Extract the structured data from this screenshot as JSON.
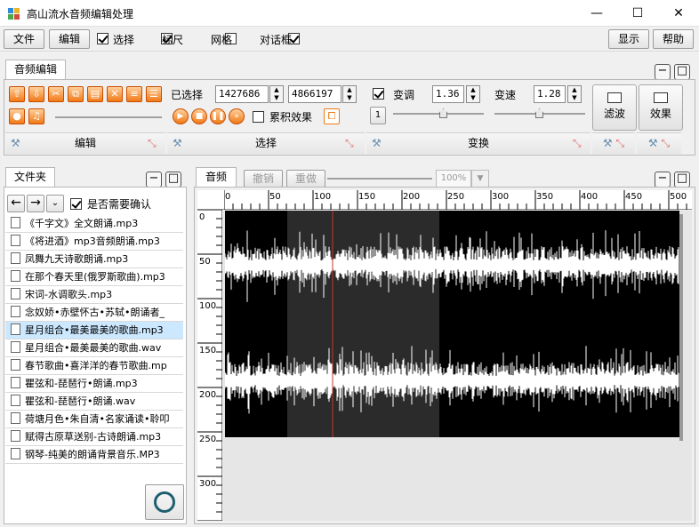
{
  "window": {
    "title": "高山流水音频编辑处理",
    "minimize": "—",
    "maximize": "☐",
    "close": "✕"
  },
  "menubar": {
    "file": "文件",
    "edit": "编辑",
    "checks": [
      {
        "label": "选择",
        "checked": true
      },
      {
        "label": "标尺",
        "checked": true
      },
      {
        "label": "网格",
        "checked": false
      },
      {
        "label": "对话框",
        "checked": true
      }
    ],
    "display": "显示",
    "help": "帮助"
  },
  "ribbon": {
    "tab": "音频编辑",
    "edit_group": "编辑",
    "select_group": "选择",
    "transform_group": "变换",
    "selected_label": "已选择",
    "sel_start": "1427686",
    "sel_end": "4866197",
    "accumulate_label": "累积效果",
    "pitch_label": "变调",
    "pitch_value": "1.36",
    "speed_label": "变速",
    "speed_value": "1.28",
    "one_button": "1",
    "filter_button": "滤波",
    "effect_button": "效果"
  },
  "folder": {
    "tab": "文件夹",
    "confirm_label": "是否需要确认",
    "files": [
      "《千字文》全文朗诵.mp3",
      "《将进酒》mp3音频朗诵.mp3",
      "凤舞九天诗歌朗诵.mp3",
      "在那个春天里(俄罗斯歌曲).mp3",
      "宋词-水调歌头.mp3",
      "念奴娇•赤壁怀古•苏轼•朗诵者_",
      "星月组合•最美最美的歌曲.mp3",
      "星月组合•最美最美的歌曲.wav",
      "春节歌曲•喜洋洋的春节歌曲.mp",
      "瞿弦和-琵琶行•朗诵.mp3",
      "瞿弦和-琵琶行•朗诵.wav",
      "荷塘月色•朱自清•名家诵读•聆叩",
      "赋得古原草送别-古诗朗诵.mp3",
      "钢琴-纯美的朗诵背景音乐.MP3"
    ],
    "selected_index": 6
  },
  "audio": {
    "tab": "音频",
    "undo": "撤销",
    "redo": "重做",
    "zoom": "100%",
    "hruler": [
      "0",
      "50",
      "100",
      "150",
      "200",
      "250",
      "300",
      "350",
      "400",
      "450",
      "500"
    ],
    "vruler": [
      "0",
      "50",
      "100",
      "150",
      "200",
      "250",
      "300"
    ]
  },
  "colors": {
    "accent_orange": "#f07a18",
    "wave": "#ffffff",
    "wave_bg": "#000000",
    "selection_bg": "#2b2b2b",
    "cursor": "#c0392b"
  }
}
